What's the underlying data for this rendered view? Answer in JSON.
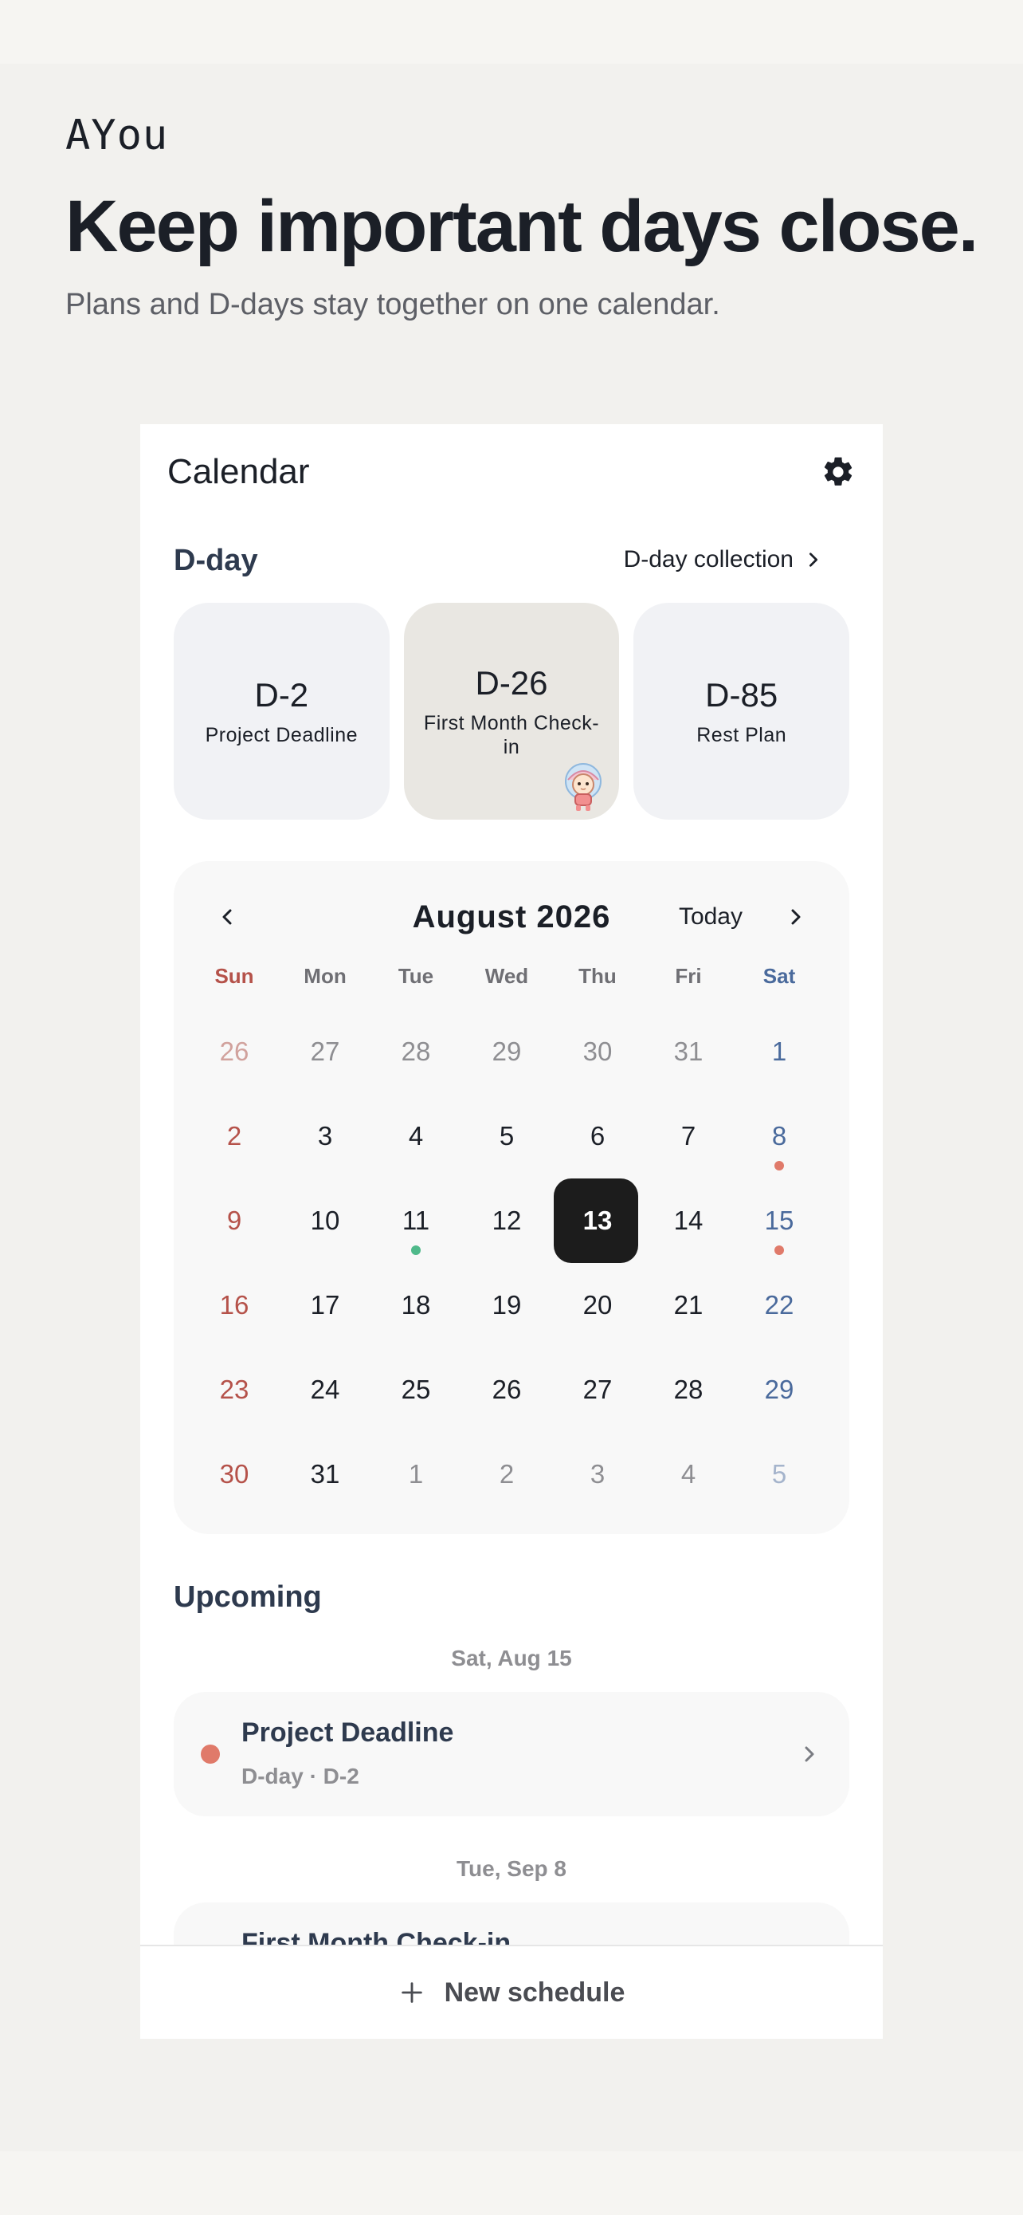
{
  "hero": {
    "brand": "AYou",
    "headline": "Keep important days close.",
    "subline": "Plans and D-days stay together on one calendar."
  },
  "header": {
    "title": "Calendar",
    "settings_icon": "gear-icon"
  },
  "dday": {
    "section_title": "D-day",
    "collection_label": "D-day collection",
    "cards": [
      {
        "count": "D-2",
        "name": "Project Deadline"
      },
      {
        "count": "D-26",
        "name": "First Month Check-in"
      },
      {
        "count": "D-85",
        "name": "Rest Plan"
      }
    ]
  },
  "calendar": {
    "month_title": "August 2026",
    "today_label": "Today",
    "weekdays": [
      "Sun",
      "Mon",
      "Tue",
      "Wed",
      "Thu",
      "Fri",
      "Sat"
    ],
    "weeks": [
      [
        "26",
        "27",
        "28",
        "29",
        "30",
        "31",
        "1"
      ],
      [
        "2",
        "3",
        "4",
        "5",
        "6",
        "7",
        "8"
      ],
      [
        "9",
        "10",
        "11",
        "12",
        "13",
        "14",
        "15"
      ],
      [
        "16",
        "17",
        "18",
        "19",
        "20",
        "21",
        "22"
      ],
      [
        "23",
        "24",
        "25",
        "26",
        "27",
        "28",
        "29"
      ],
      [
        "30",
        "31",
        "1",
        "2",
        "3",
        "4",
        "5"
      ]
    ],
    "selected_day": "13",
    "colors": {
      "sunday": "#b5524a",
      "saturday": "#4a6a9c",
      "dot_coral": "#e07a6a",
      "dot_green": "#4fb98a",
      "selected_bg": "#1c1c1c"
    }
  },
  "upcoming": {
    "section_title": "Upcoming",
    "groups": [
      {
        "date": "Sat, Aug 15",
        "title": "Project Deadline",
        "subtitle": "D-day · D-2"
      },
      {
        "date": "Tue, Sep 8",
        "title": "First Month Check-in",
        "subtitle": ""
      }
    ]
  },
  "bottom": {
    "new_schedule_label": "New schedule"
  }
}
